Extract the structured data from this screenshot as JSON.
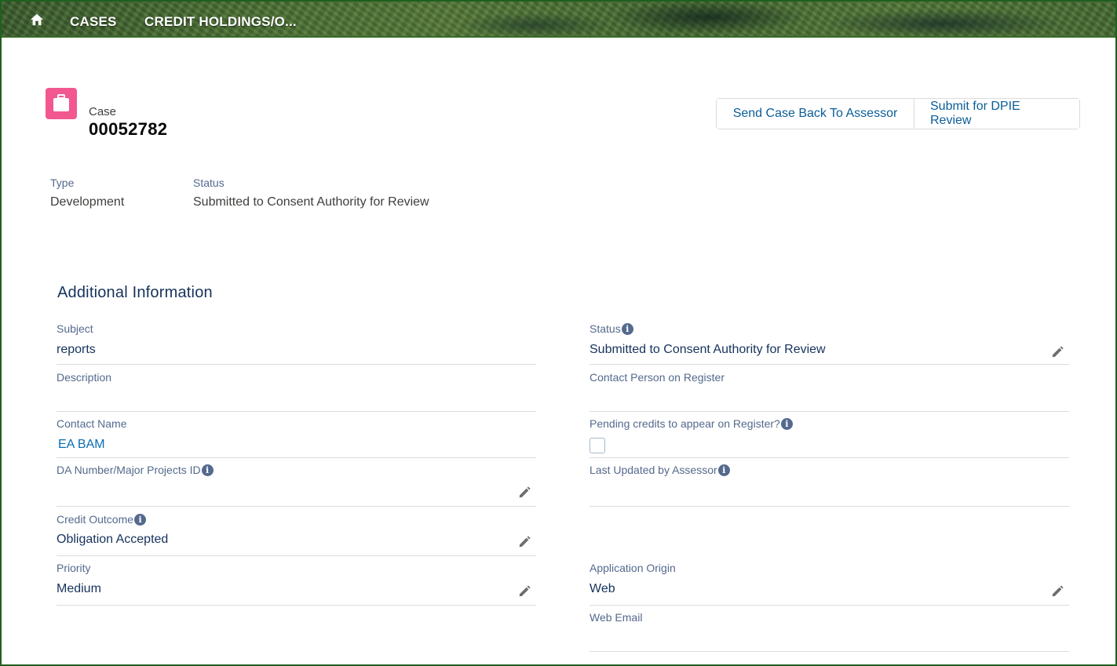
{
  "nav": {
    "items": [
      "CASES",
      "CREDIT HOLDINGS/O..."
    ]
  },
  "header": {
    "object_label": "Case",
    "case_number": "00052782",
    "actions": [
      "Send Case Back To Assessor",
      "Submit for DPIE Review"
    ]
  },
  "highlights": [
    {
      "label": "Type",
      "value": "Development"
    },
    {
      "label": "Status",
      "value": "Submitted to Consent Authority for Review"
    }
  ],
  "section": {
    "title": "Additional Information",
    "left": [
      {
        "label": "Subject",
        "value": "reports"
      },
      {
        "label": "Description",
        "value": ""
      },
      {
        "label": "Contact Name",
        "value": "EA BAM"
      },
      {
        "label": "DA Number/Major Projects ID",
        "value": ""
      },
      {
        "label": "Credit Outcome",
        "value": "Obligation Accepted"
      },
      {
        "label": "Priority",
        "value": "Medium"
      }
    ],
    "right": [
      {
        "label": "Status",
        "value": "Submitted to Consent Authority for Review"
      },
      {
        "label": "Contact Person on Register",
        "value": ""
      },
      {
        "label": "Pending credits to appear on Register?",
        "value": ""
      },
      {
        "label": "Last Updated by Assessor",
        "value": ""
      },
      {
        "label": "Application Origin",
        "value": "Web"
      },
      {
        "label": "Web Email",
        "value": ""
      }
    ]
  },
  "colors": {
    "case_icon": "#f2578f",
    "link": "#0b6cb3",
    "button_text": "#0b5d97",
    "frame_border": "#1f5f1f"
  },
  "icons": {
    "home": "home-icon",
    "case": "briefcase-icon",
    "info": "info-icon",
    "edit": "pencil-icon"
  }
}
